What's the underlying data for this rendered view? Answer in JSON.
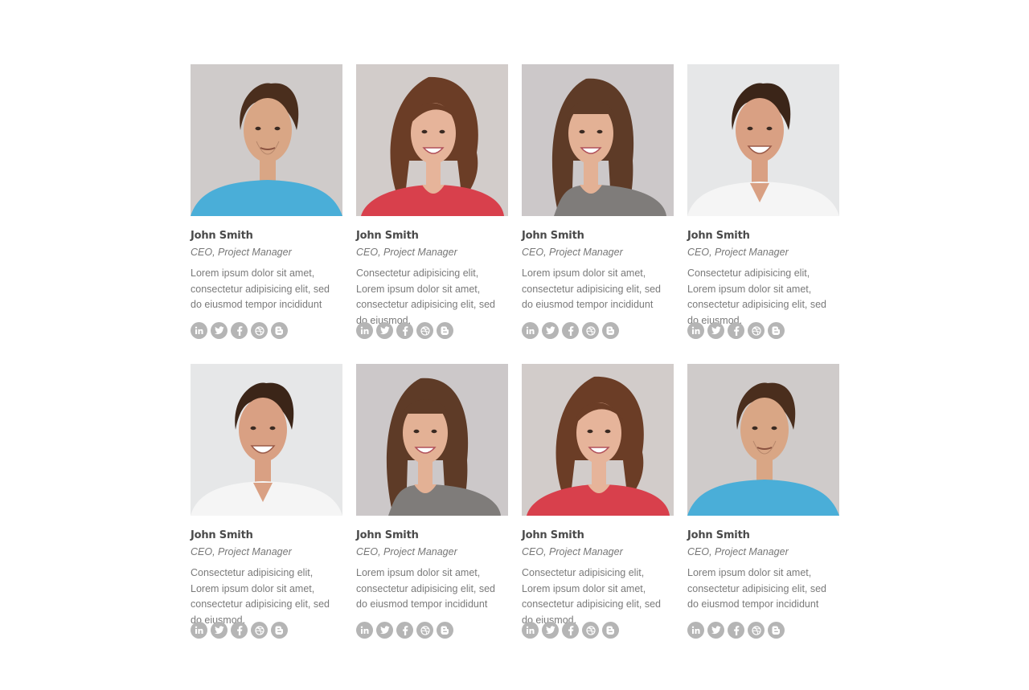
{
  "palette": {
    "icon_bg": "#b5b5b5",
    "name_color": "#4a4a4a",
    "text_color": "#7a7a7a"
  },
  "members": [
    {
      "name": "John Smith",
      "role": "CEO, Project Manager",
      "bio": "Lorem ipsum dolor sit amet, consectetur adipisicing elit, sed do eiusmod tempor incididunt",
      "photo": "man-blue-shirt",
      "bg": "#cbc7c6",
      "hair": "#4a2e1d",
      "skin": "#d9a685",
      "shirt": "#4aaed8",
      "style": "man"
    },
    {
      "name": "John Smith",
      "role": "CEO, Project Manager",
      "bio": "Consectetur adipisicing elit, Lorem ipsum dolor sit amet, consectetur adipisicing elit, sed do eiusmod.",
      "photo": "woman-red-shirt",
      "bg": "#cfc8c6",
      "hair": "#6b3d26",
      "skin": "#e6b49a",
      "shirt": "#d8404c",
      "style": "woman-curly"
    },
    {
      "name": "John Smith",
      "role": "CEO, Project Manager",
      "bio": "Lorem ipsum dolor sit amet, consectetur adipisicing elit, sed do eiusmod tempor incididunt",
      "photo": "woman-grey-shirt",
      "bg": "#c8c4c5",
      "hair": "#5e3b27",
      "skin": "#e3b195",
      "shirt": "#7f7c7a",
      "style": "woman-straight"
    },
    {
      "name": "John Smith",
      "role": "CEO, Project Manager",
      "bio": "Consectetur adipisicing elit, Lorem ipsum dolor sit amet, consectetur adipisicing elit, sed do eiusmod.",
      "photo": "man-white-shirt",
      "bg": "#e4e5e6",
      "hair": "#3b2518",
      "skin": "#d9a083",
      "shirt": "#f5f5f5",
      "style": "man-smile"
    },
    {
      "name": "John Smith",
      "role": "CEO, Project Manager",
      "bio": "Consectetur adipisicing elit, Lorem ipsum dolor sit amet, consectetur adipisicing elit, sed do eiusmod.",
      "photo": "man-white-shirt",
      "bg": "#e4e5e6",
      "hair": "#3b2518",
      "skin": "#d9a083",
      "shirt": "#f5f5f5",
      "style": "man-smile"
    },
    {
      "name": "John Smith",
      "role": "CEO, Project Manager",
      "bio": "Lorem ipsum dolor sit amet, consectetur adipisicing elit, sed do eiusmod tempor incididunt",
      "photo": "woman-grey-shirt",
      "bg": "#c8c4c5",
      "hair": "#5e3b27",
      "skin": "#e3b195",
      "shirt": "#7f7c7a",
      "style": "woman-straight"
    },
    {
      "name": "John Smith",
      "role": "CEO, Project Manager",
      "bio": "Consectetur adipisicing elit, Lorem ipsum dolor sit amet, consectetur adipisicing elit, sed do eiusmod.",
      "photo": "woman-red-shirt",
      "bg": "#cfc8c6",
      "hair": "#6b3d26",
      "skin": "#e6b49a",
      "shirt": "#d8404c",
      "style": "woman-curly"
    },
    {
      "name": "John Smith",
      "role": "CEO, Project Manager",
      "bio": "Lorem ipsum dolor sit amet, consectetur adipisicing elit, sed do eiusmod tempor incididunt",
      "photo": "man-blue-shirt",
      "bg": "#cbc7c6",
      "hair": "#4a2e1d",
      "skin": "#d9a685",
      "shirt": "#4aaed8",
      "style": "man"
    }
  ],
  "social_icons": [
    "linkedin-icon",
    "twitter-icon",
    "facebook-icon",
    "dribbble-icon",
    "blogger-icon"
  ]
}
